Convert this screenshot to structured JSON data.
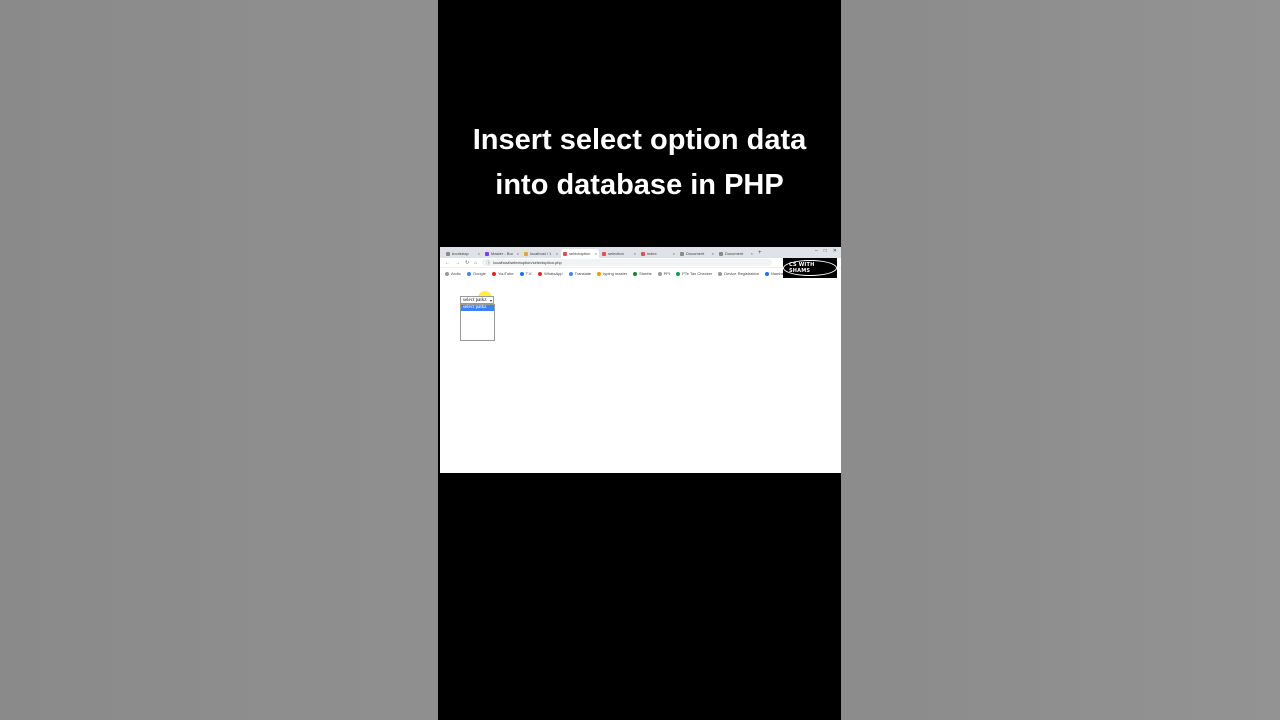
{
  "title": {
    "line1": "Insert select option data",
    "line2": "into database in PHP"
  },
  "browser": {
    "tabs": [
      {
        "label": "bootstrap",
        "active": false
      },
      {
        "label": "Master - Bor",
        "active": false
      },
      {
        "label": "localhost / 1",
        "active": false
      },
      {
        "label": "selectoption",
        "active": true
      },
      {
        "label": "selection",
        "active": false
      },
      {
        "label": "index",
        "active": false
      },
      {
        "label": "Document",
        "active": false
      },
      {
        "label": "Document",
        "active": false
      }
    ],
    "new_tab": "+",
    "window_controls": [
      "–",
      "□",
      "✕"
    ],
    "url": "localhost/selectoption/selectoption.php",
    "bookmarks": [
      "Arctic",
      "Google",
      "YouTube",
      "T.V.",
      "WhatsApp",
      "Translate",
      "typing master",
      "Sheets",
      "PPI",
      "PTe Tax Checker",
      "Device Registration",
      "Numbers keyboard"
    ],
    "watermark": "CS WITH SHAMS"
  },
  "page": {
    "select_value": "select patkz",
    "dropdown_options": [
      "select patkz"
    ]
  }
}
